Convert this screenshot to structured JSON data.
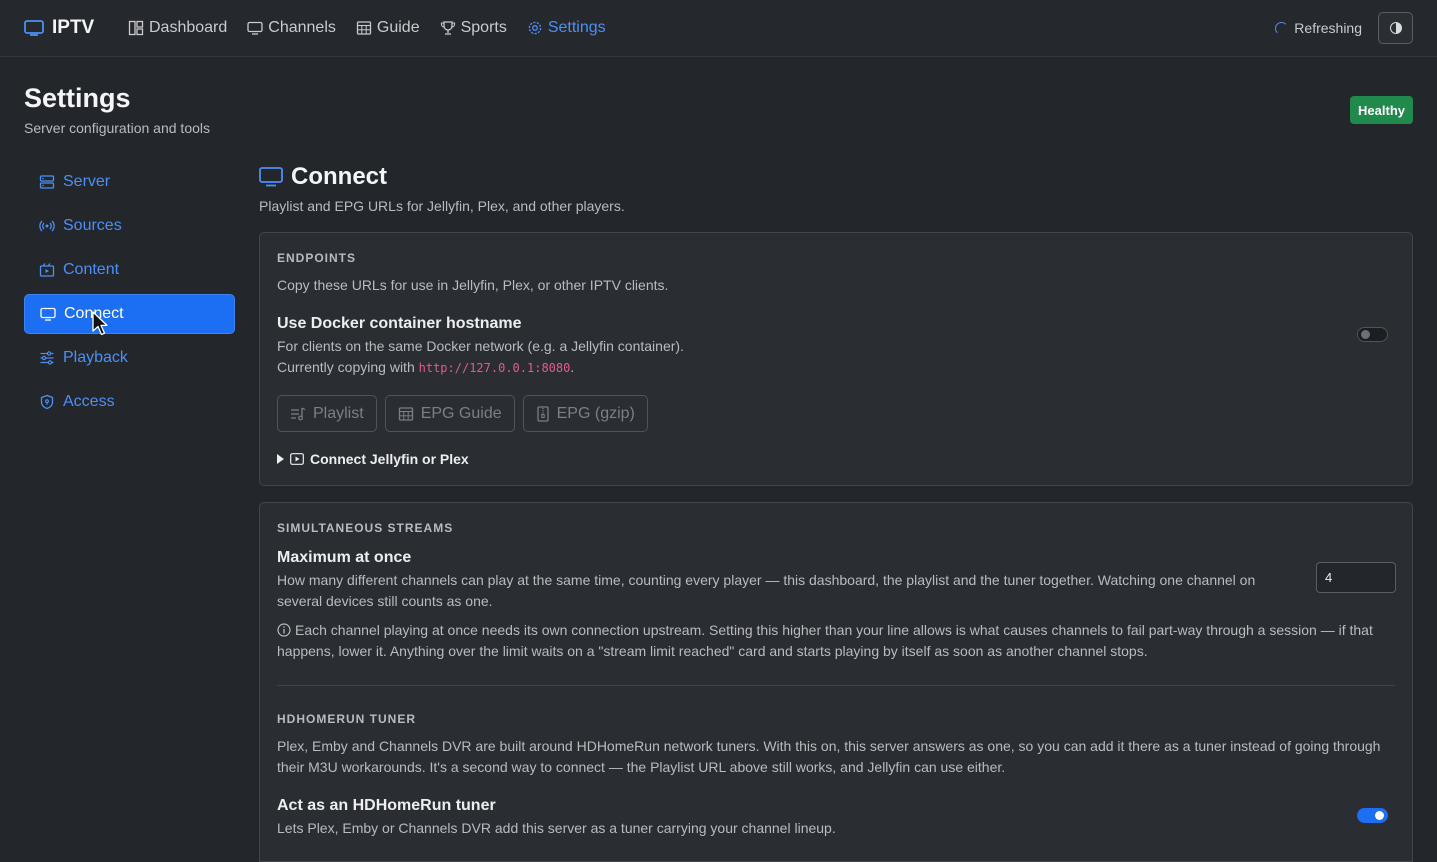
{
  "app": {
    "brand": "IPTV"
  },
  "nav": {
    "items": [
      {
        "label": "Dashboard",
        "icon": "dashboard-icon",
        "active": false
      },
      {
        "label": "Channels",
        "icon": "tv-icon",
        "active": false
      },
      {
        "label": "Guide",
        "icon": "calendar-grid-icon",
        "active": false
      },
      {
        "label": "Sports",
        "icon": "trophy-icon",
        "active": false
      },
      {
        "label": "Settings",
        "icon": "gear-icon",
        "active": true
      }
    ],
    "status": "Refreshing"
  },
  "page": {
    "title": "Settings",
    "subtitle": "Server configuration and tools",
    "health_badge": "Healthy"
  },
  "sidebar": {
    "items": [
      {
        "label": "Server",
        "icon": "server-icon",
        "active": false
      },
      {
        "label": "Sources",
        "icon": "broadcast-icon",
        "active": false
      },
      {
        "label": "Content",
        "icon": "film-icon",
        "active": false
      },
      {
        "label": "Connect",
        "icon": "monitor-icon",
        "active": true
      },
      {
        "label": "Playback",
        "icon": "sliders-icon",
        "active": false
      },
      {
        "label": "Access",
        "icon": "shield-icon",
        "active": false
      }
    ]
  },
  "section": {
    "title": "Connect",
    "subtitle": "Playlist and EPG URLs for Jellyfin, Plex, and other players."
  },
  "endpoints": {
    "heading": "ENDPOINTS",
    "description": "Copy these URLs for use in Jellyfin, Plex, or other IPTV clients.",
    "docker_title": "Use Docker container hostname",
    "docker_desc": "For clients on the same Docker network (e.g. a Jellyfin container).",
    "copying_prefix": "Currently copying with ",
    "copying_url": "http://127.0.0.1:8080",
    "copying_suffix": ".",
    "docker_toggle_on": false,
    "buttons": [
      {
        "label": "Playlist",
        "icon": "playlist-icon"
      },
      {
        "label": "EPG Guide",
        "icon": "calendar-grid-icon"
      },
      {
        "label": "EPG (gzip)",
        "icon": "archive-icon"
      }
    ],
    "details_label": "Connect Jellyfin or Plex"
  },
  "streams": {
    "heading": "SIMULTANEOUS STREAMS",
    "max_title": "Maximum at once",
    "max_desc": "How many different channels can play at the same time, counting every player — this dashboard, the playlist and the tuner together. Watching one channel on several devices still counts as one.",
    "max_value": "4",
    "info": "Each channel playing at once needs its own connection upstream. Setting this higher than your line allows is what causes channels to fail part-way through a session — if that happens, lower it. Anything over the limit waits on a \"stream limit reached\" card and starts playing by itself as soon as another channel stops."
  },
  "hdhomerun": {
    "heading": "HDHOMERUN TUNER",
    "description": "Plex, Emby and Channels DVR are built around HDHomeRun network tuners. With this on, this server answers as one, so you can add it there as a tuner instead of going through their M3U workarounds. It's a second way to connect — the Playlist URL above still works, and Jellyfin can use either.",
    "tuner_title": "Act as an HDHomeRun tuner",
    "tuner_desc": "Lets Plex, Emby or Channels DVR add this server as a tuner carrying your channel lineup.",
    "tuner_toggle_on": true
  },
  "colors": {
    "accent": "#1c6ef2",
    "link": "#4d8ff5",
    "healthy": "#1f8a4c",
    "code": "#e25c8c"
  }
}
